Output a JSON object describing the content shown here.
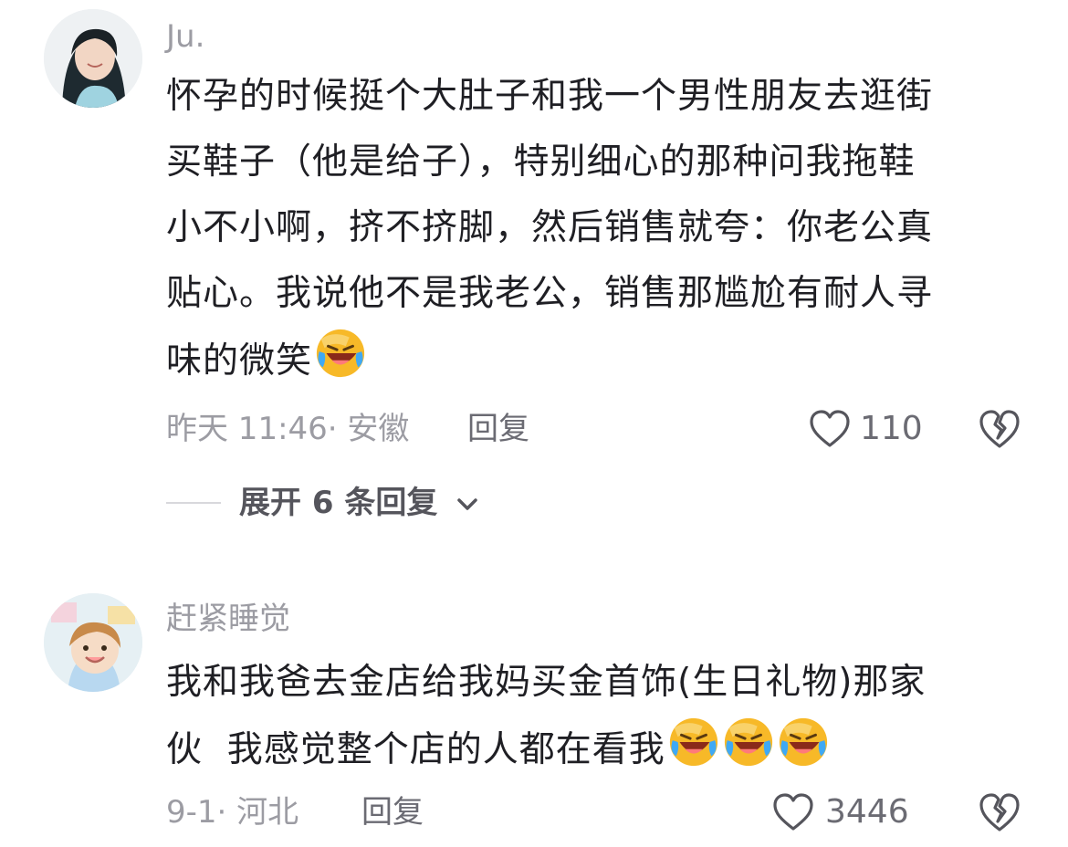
{
  "comments": [
    {
      "username": "Ju.",
      "lines": [
        "怀孕的时候挺个大肚子和我一个男性朋友去逛街",
        "买鞋子（他是给子），特别细心的那种问我拖鞋",
        "小不小啊，挤不挤脚，然后销售就夸：你老公真",
        "贴心。我说他不是我老公，销售那尴尬有耐人寻",
        "味的微笑"
      ],
      "emoji": "laughing-crying-emoji",
      "time_location": "昨天 11:46· 安徽",
      "reply_label": "回复",
      "like_count": "110",
      "expand_label": "展开 6 条回复"
    },
    {
      "username": "赶紧睡觉",
      "lines": [
        "我和我爸去金店给我妈买金首饰(生日礼物)那家",
        "伙  我感觉整个店的人都在看我"
      ],
      "emoji": "laughing-crying-emoji",
      "time_location": "9-1· 河北",
      "reply_label": "回复",
      "like_count": "3446"
    }
  ],
  "colors": {
    "text_primary": "#1f1f24",
    "text_secondary": "#9c9ca3",
    "emoji_face": "#f7b928"
  },
  "icons": [
    "heart-outline-icon",
    "broken-heart-icon",
    "chevron-down-icon"
  ]
}
